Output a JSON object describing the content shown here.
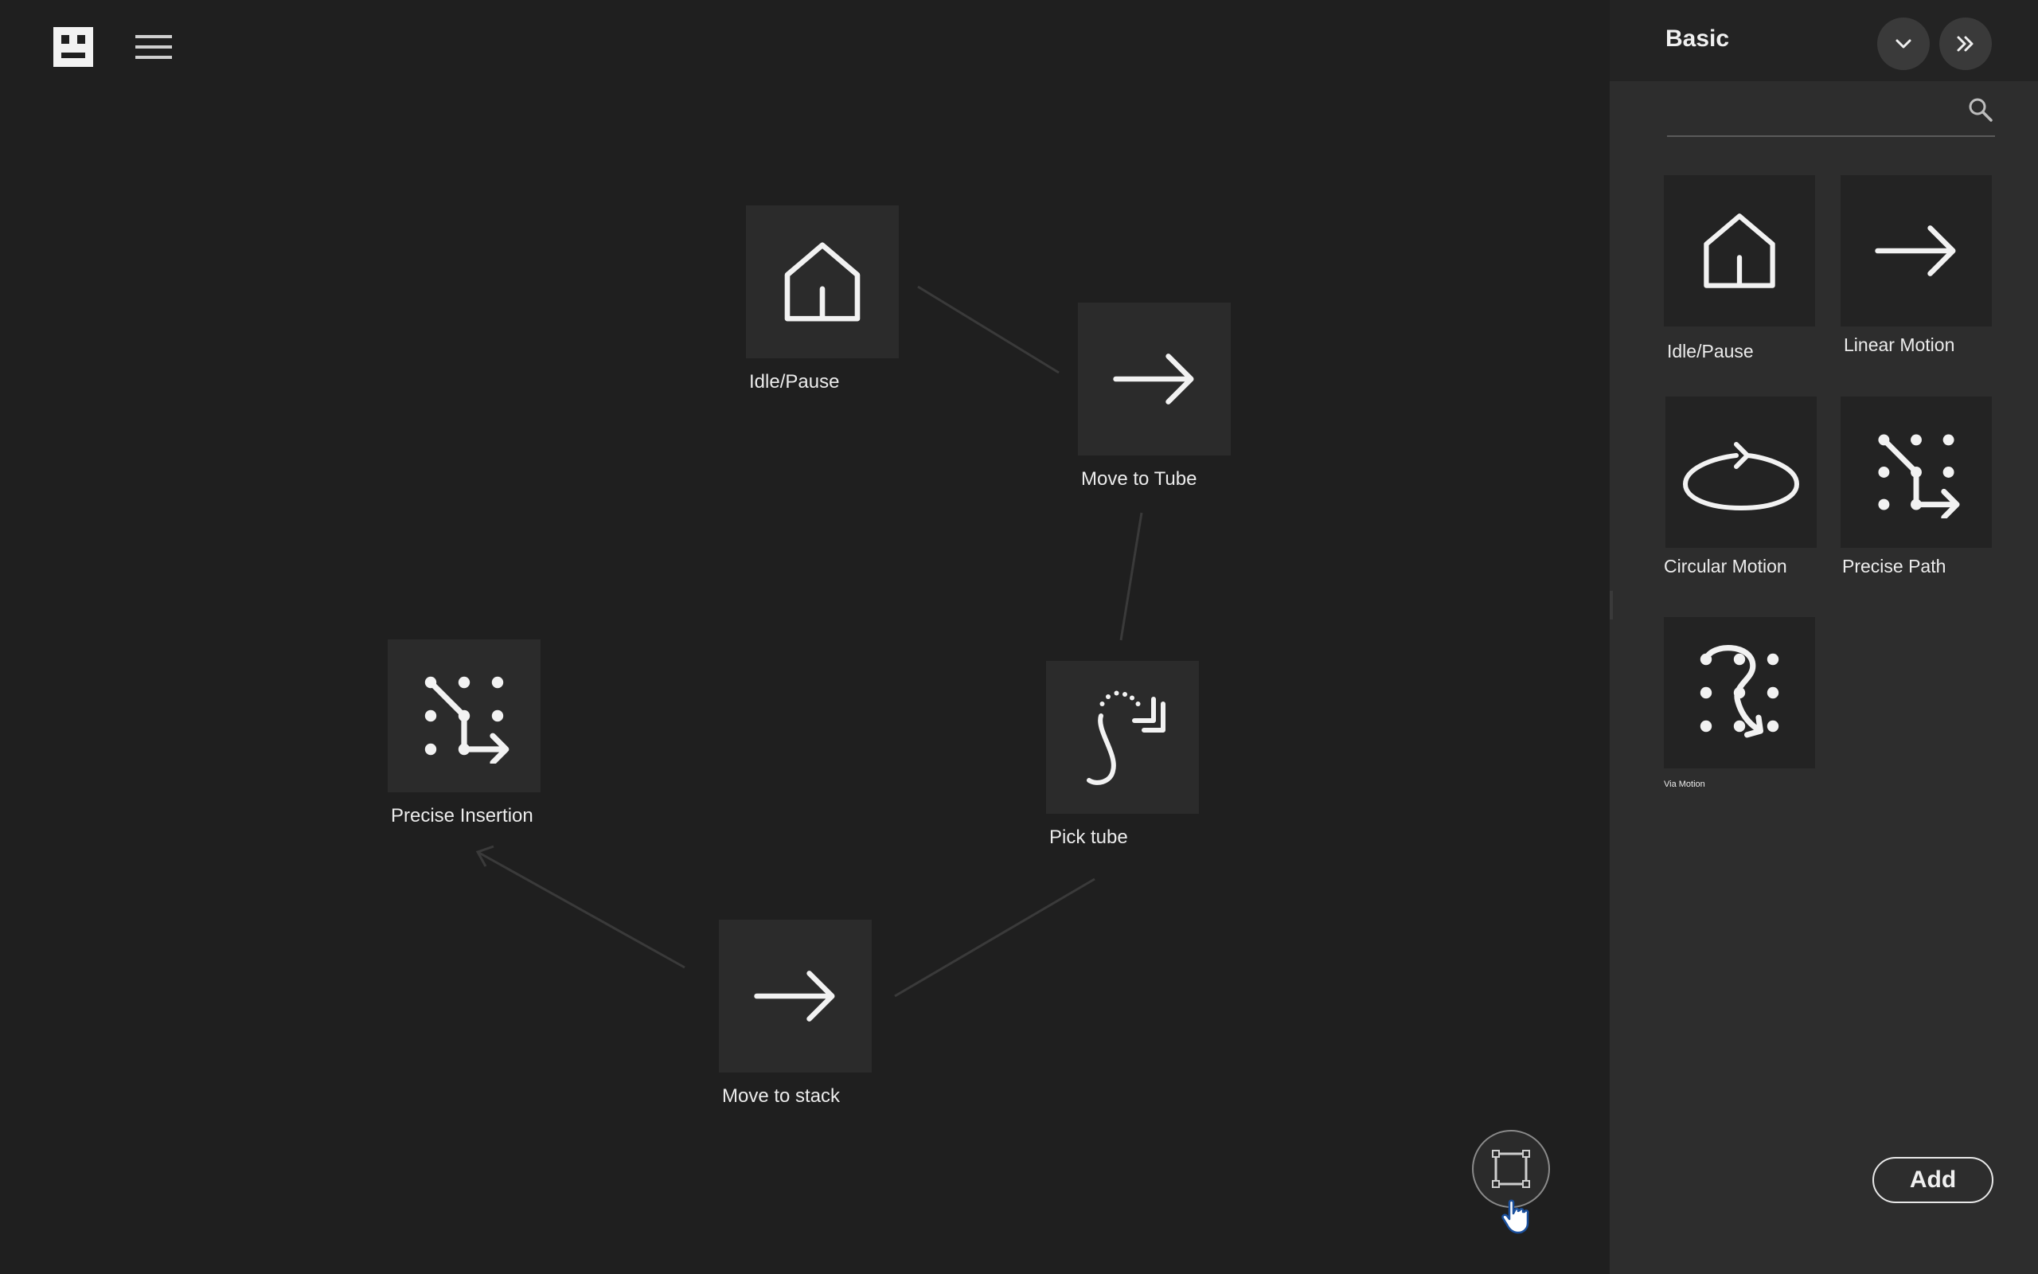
{
  "colors": {
    "canvas_bg": "#1f1f1f",
    "node_bg": "#2b2b2b",
    "panel_bg": "#2d2d2d",
    "panel_header_bg": "#232323",
    "edge": "#3a3a3a",
    "icon_stroke": "#f2f2f2"
  },
  "topbar": {
    "logo_icon": "robot-face-icon",
    "menu_icon": "hamburger-menu-icon"
  },
  "canvas": {
    "nodes": [
      {
        "id": "idle",
        "label": "Idle/Pause",
        "icon": "home-icon"
      },
      {
        "id": "move_tube",
        "label": "Move to Tube",
        "icon": "arrow-right-icon"
      },
      {
        "id": "pick_tube",
        "label": "Pick tube",
        "icon": "pick-tube-icon"
      },
      {
        "id": "move_stack",
        "label": "Move to stack",
        "icon": "arrow-right-icon"
      },
      {
        "id": "precise_insertion",
        "label": "Precise Insertion",
        "icon": "precise-path-icon"
      }
    ],
    "fit_button_icon": "fit-to-screen-icon"
  },
  "panel": {
    "title": "Basic",
    "collapse_icon": "chevron-down-icon",
    "expand_icon": "double-chevron-right-icon",
    "search": {
      "placeholder": "",
      "value": "",
      "icon": "search-icon"
    },
    "tiles": [
      {
        "label": "Idle/Pause",
        "icon": "home-icon"
      },
      {
        "label": "Linear Motion",
        "icon": "arrow-right-icon"
      },
      {
        "label": "Circular Motion",
        "icon": "circular-motion-icon"
      },
      {
        "label": "Precise Path",
        "icon": "precise-path-icon"
      },
      {
        "label": "Via Motion",
        "icon": "via-motion-icon"
      }
    ],
    "add_label": "Add"
  }
}
